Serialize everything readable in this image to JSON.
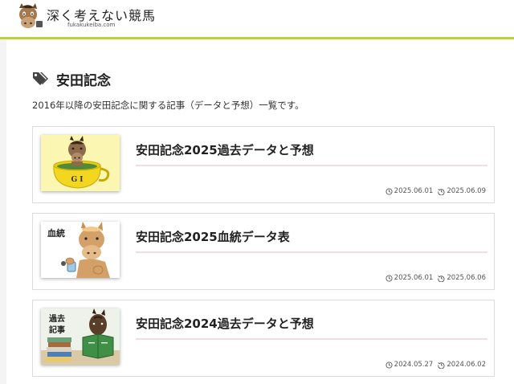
{
  "site": {
    "title": "深く考えない競馬",
    "url": "fukakukeiba.com",
    "logo_icon": "horse-head-logo-icon"
  },
  "page": {
    "tag_icon": "tags-icon",
    "title": "安田記念",
    "description": "2016年以降の安田記念に関する記事（データと予想）一覧です。"
  },
  "accent_color": "#b7d334",
  "articles": [
    {
      "title": "安田記念2025過去データと予想",
      "thumb_label": "G I",
      "published": "2025.06.01",
      "updated": "2025.06.09"
    },
    {
      "title": "安田記念2025血統データ表",
      "thumb_label": "血統",
      "published": "2025.06.01",
      "updated": "2025.06.06"
    },
    {
      "title": "安田記念2024過去データと予想",
      "thumb_label": "過去\n記事",
      "published": "2024.05.27",
      "updated": "2024.06.02"
    }
  ]
}
